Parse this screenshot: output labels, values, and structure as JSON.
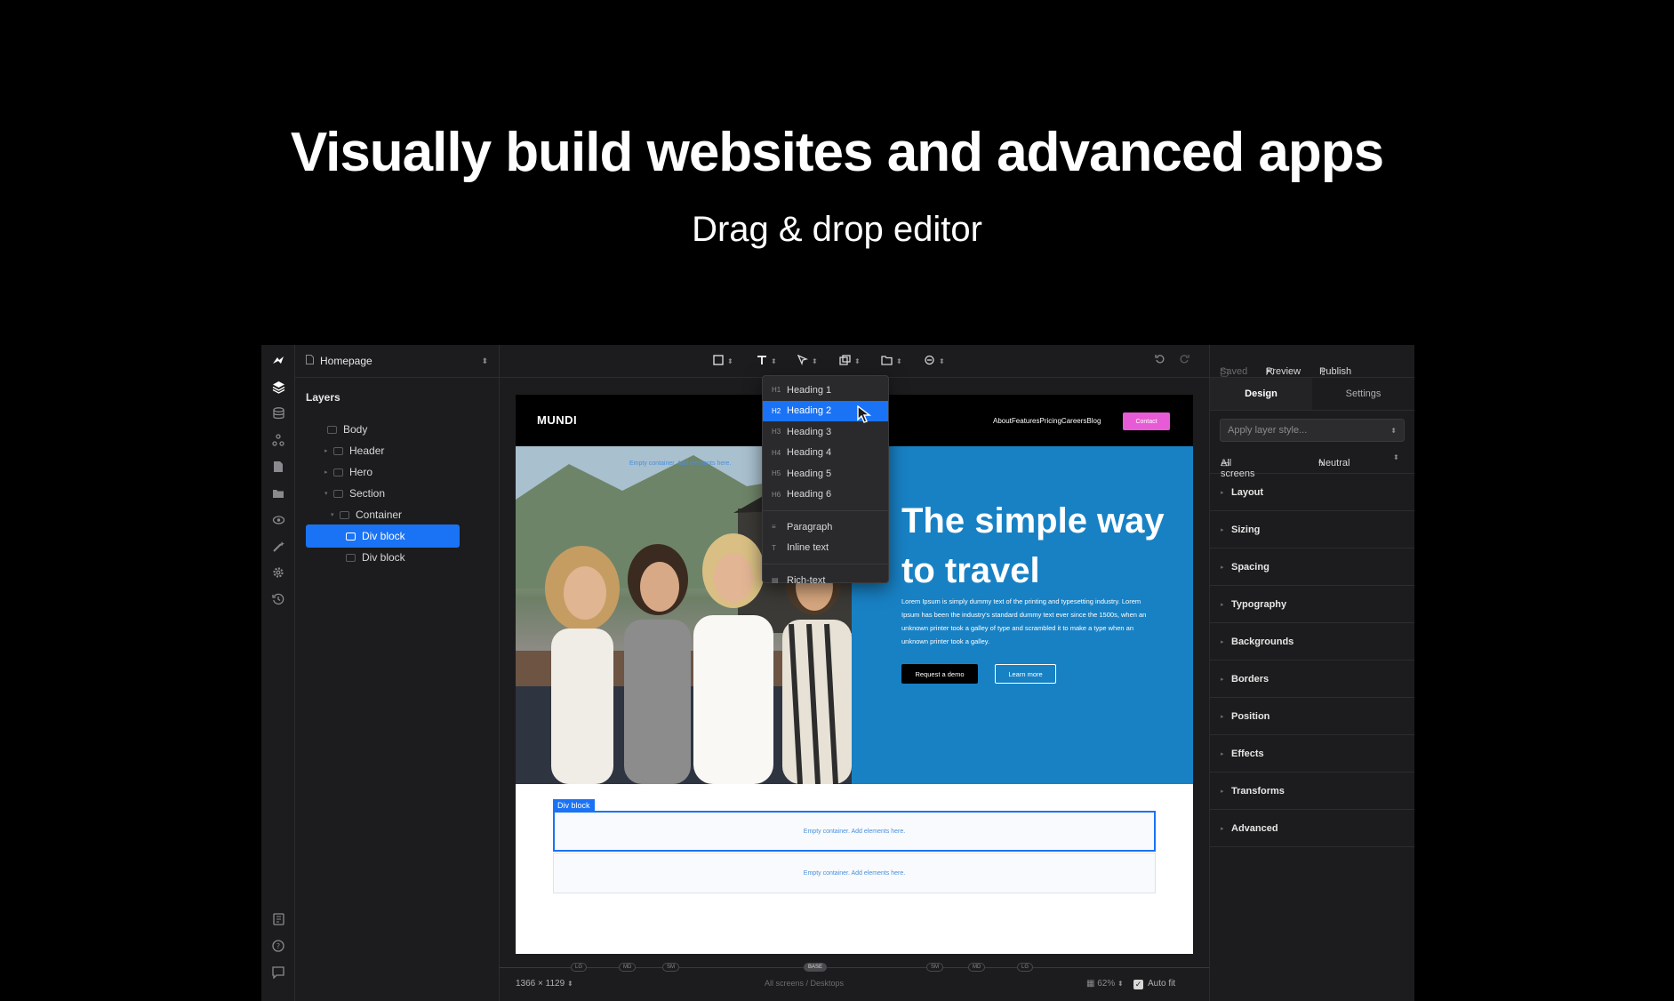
{
  "headline": "Visually build websites and advanced apps",
  "subheadline": "Drag & drop editor",
  "page_selector": {
    "label": "Homepage"
  },
  "layers_panel": {
    "title": "Layers",
    "tree": [
      {
        "label": "Body",
        "depth": 0,
        "expandable": false,
        "selected": false
      },
      {
        "label": "Header",
        "depth": 1,
        "expandable": true,
        "selected": false
      },
      {
        "label": "Hero",
        "depth": 1,
        "expandable": true,
        "selected": false
      },
      {
        "label": "Section",
        "depth": 1,
        "expandable": true,
        "expanded": true,
        "selected": false
      },
      {
        "label": "Container",
        "depth": 2,
        "expandable": true,
        "expanded": true,
        "selected": false
      },
      {
        "label": "Div block",
        "depth": 3,
        "expandable": false,
        "selected": true
      },
      {
        "label": "Div block",
        "depth": 3,
        "expandable": false,
        "selected": false
      }
    ]
  },
  "text_menu": {
    "items": [
      {
        "tag": "H1",
        "label": "Heading 1"
      },
      {
        "tag": "H2",
        "label": "Heading 2",
        "highlighted": true
      },
      {
        "tag": "H3",
        "label": "Heading 3"
      },
      {
        "tag": "H4",
        "label": "Heading 4"
      },
      {
        "tag": "H5",
        "label": "Heading 5"
      },
      {
        "tag": "H6",
        "label": "Heading 6"
      }
    ],
    "extra": [
      {
        "icon": "paragraph-icon",
        "label": "Paragraph"
      },
      {
        "icon": "text-icon",
        "label": "Inline text"
      }
    ],
    "rich": {
      "icon": "rich-text-icon",
      "label": "Rich-text"
    }
  },
  "site_preview": {
    "brand": "MUNDI",
    "nav_links": "AboutFeaturesPricingCareersBlog",
    "contact_button": "Contact",
    "empty_tip": "Empty container. Add elements here.",
    "hero_heading": "The simple way to travel",
    "hero_text": "Lorem Ipsum is simply dummy text of the printing and typesetting industry. Lorem Ipsum has been the industry's standard dummy text ever since the 1500s, when an unknown printer took a galley of type and scrambled it to make a type when an unknown printer took a galley.",
    "primary_button": "Request a demo",
    "secondary_button": "Learn more",
    "div_tag": "Div block",
    "empty_div_1": "Empty container. Add elements here.",
    "empty_div_2": "Empty container. Add elements here."
  },
  "breakpoints": [
    "LG",
    "MD",
    "SM",
    "BASE",
    "SM",
    "MD",
    "LG"
  ],
  "status_bar": {
    "dimensions": "1366 × 1129",
    "screens": "All screens / Desktops",
    "zoom": "62%",
    "autofit": "Auto fit"
  },
  "right_top": {
    "saved": "Saved",
    "preview": "Preview",
    "publish": "Publish"
  },
  "right_tabs": [
    "Design",
    "Settings"
  ],
  "style_select": {
    "placeholder": "Apply layer style..."
  },
  "screens_row": {
    "screens": "All screens",
    "state": "Neutral"
  },
  "sections": [
    "Layout",
    "Sizing",
    "Spacing",
    "Typography",
    "Backgrounds",
    "Borders",
    "Position",
    "Effects",
    "Transforms",
    "Advanced"
  ],
  "colors": {
    "accent": "#1a73f5",
    "hero_blue": "#1881c4",
    "contact_pink": "#e85bd6",
    "panel_bg": "#1c1c1e"
  }
}
